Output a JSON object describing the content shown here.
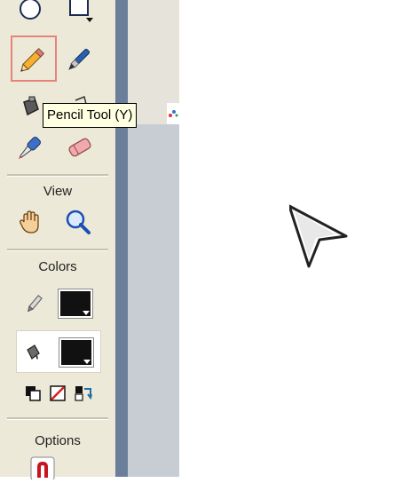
{
  "toolbar": {
    "sections": {
      "view_label": "View",
      "colors_label": "Colors",
      "options_label": "Options"
    },
    "tools": [
      {
        "name": "oval-tool",
        "icon": "circle-icon"
      },
      {
        "name": "rectangle-tool",
        "icon": "rectangle-icon"
      },
      {
        "name": "pencil-tool",
        "icon": "pencil-icon",
        "selected": true
      },
      {
        "name": "brush-tool",
        "icon": "brush-icon"
      },
      {
        "name": "ink-bottle-tool",
        "icon": "ink-bottle-icon"
      },
      {
        "name": "paint-bucket-tool",
        "icon": "paint-bucket-icon"
      },
      {
        "name": "eyedropper-tool",
        "icon": "eyedropper-icon"
      },
      {
        "name": "eraser-tool",
        "icon": "eraser-icon"
      },
      {
        "name": "hand-tool",
        "icon": "hand-icon"
      },
      {
        "name": "zoom-tool",
        "icon": "magnifier-icon"
      }
    ],
    "colors": {
      "stroke_color": "#111111",
      "fill_color": "#111111",
      "selected_border": "#e8837b"
    }
  },
  "tooltip": {
    "text": "Pencil Tool (Y)"
  }
}
